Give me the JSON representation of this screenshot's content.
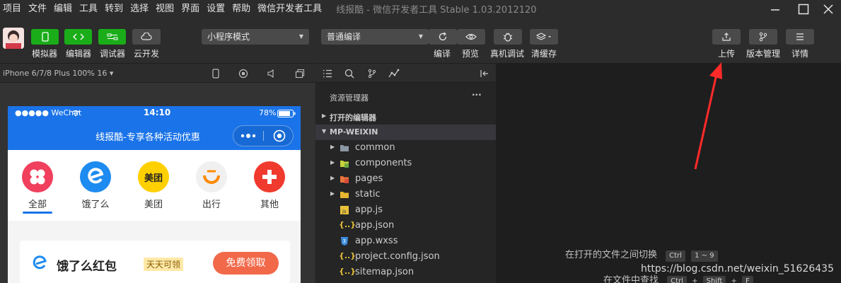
{
  "menu": [
    "项目",
    "文件",
    "编辑",
    "工具",
    "转到",
    "选择",
    "视图",
    "界面",
    "设置",
    "帮助",
    "微信开发者工具"
  ],
  "app_title": "线报酷 - 微信开发者工具 Stable 1.03.2012120",
  "toolbar": {
    "left_buttons": [
      {
        "label": "模拟器",
        "icon": "phone-icon"
      },
      {
        "label": "编辑器",
        "icon": "code-icon"
      },
      {
        "label": "调试器",
        "icon": "debug-toggle-icon"
      },
      {
        "label": "云开发",
        "icon": "cloud-icon"
      }
    ],
    "mode_select": "小程序模式",
    "compile_select": "普通编译",
    "mid_buttons": [
      {
        "label": "编译",
        "icon": "refresh-icon"
      },
      {
        "label": "预览",
        "icon": "eye-icon"
      },
      {
        "label": "真机调试",
        "icon": "bug-icon"
      },
      {
        "label": "清缓存",
        "icon": "layers-icon"
      }
    ],
    "right_buttons": [
      {
        "label": "上传",
        "icon": "upload-icon"
      },
      {
        "label": "版本管理",
        "icon": "branch-icon"
      },
      {
        "label": "详情",
        "icon": "menu-icon"
      }
    ]
  },
  "simulator": {
    "device": "iPhone 6/7/8 Plus 100% 16 ▾",
    "status_left": "●●●●● WeChat",
    "status_time": "14:10",
    "status_battery": "78%",
    "nav_title": "线报酷-专享各种活动优惠",
    "categories": [
      {
        "label": "全部",
        "color": "#f0405e"
      },
      {
        "label": "饿了么",
        "color": "#1e8bf0"
      },
      {
        "label": "美团",
        "color": "#ffd000",
        "text": "美团"
      },
      {
        "label": "出行",
        "color": "#f0f0f0"
      },
      {
        "label": "其他",
        "color": "#f03a2e"
      }
    ],
    "coupon": {
      "title": "饿了么红包",
      "tag": "天天可领",
      "button": "免费领取"
    }
  },
  "explorer": {
    "title": "资源管理器",
    "more": "···",
    "open_editors": "打开的编辑器",
    "project": "MP-WEIXIN",
    "folders": [
      {
        "name": "common",
        "color": "#8c98a4"
      },
      {
        "name": "components",
        "color": "#c7d23b"
      },
      {
        "name": "pages",
        "color": "#e8743b"
      },
      {
        "name": "static",
        "color": "#e8b730"
      }
    ],
    "files": [
      {
        "name": "app.js",
        "type": "js"
      },
      {
        "name": "app.json",
        "type": "json"
      },
      {
        "name": "app.wxss",
        "type": "css"
      },
      {
        "name": "project.config.json",
        "type": "json"
      },
      {
        "name": "sitemap.json",
        "type": "json"
      }
    ]
  },
  "editor": {
    "hint1": "在打开的文件之间切换",
    "hint1_keys": [
      "Ctrl",
      "1 ~ 9"
    ],
    "hint2": "在文件中查找",
    "hint2_keys": [
      "Ctrl",
      "+",
      "Shift",
      "+",
      "F"
    ],
    "watermark": "https://blog.csdn.net/weixin_51626435"
  },
  "annotation_color": "#ff2a2a"
}
